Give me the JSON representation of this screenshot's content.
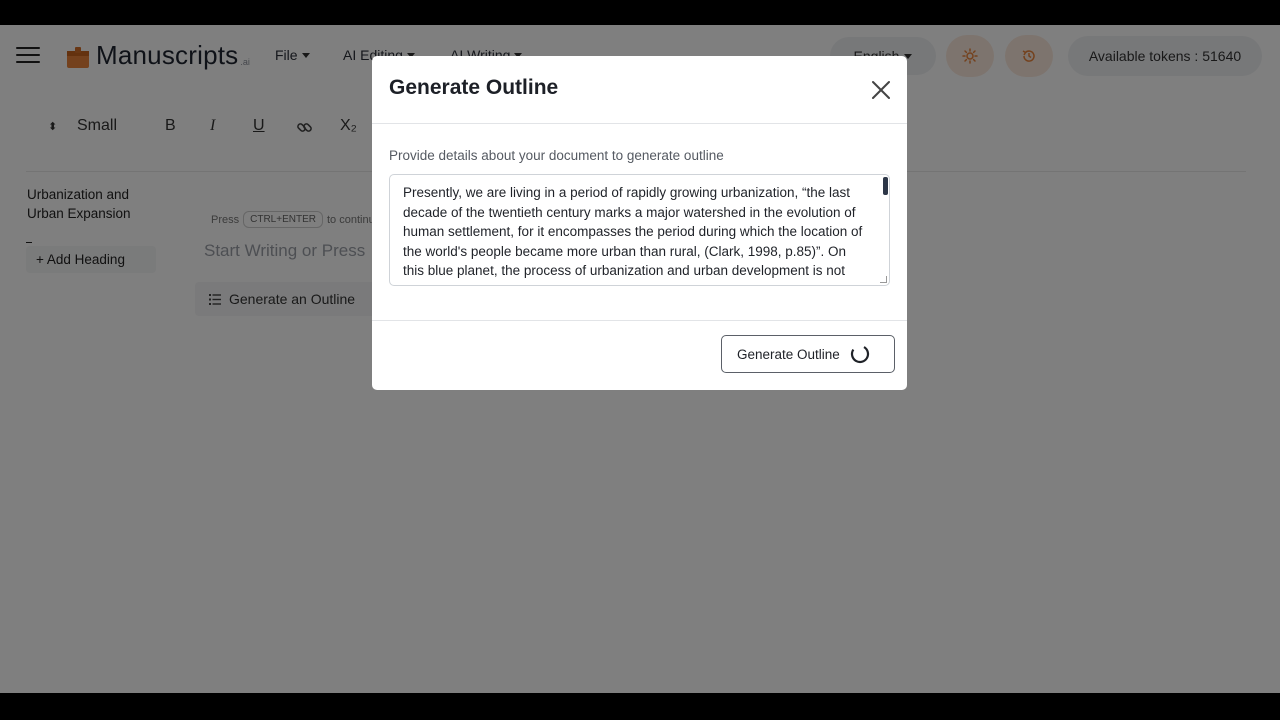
{
  "header": {
    "logo_text": "Manuscripts",
    "logo_suffix": ".ai",
    "menus": [
      {
        "label": "File"
      },
      {
        "label": "AI Editing"
      },
      {
        "label": "AI Writing"
      }
    ],
    "language": "English",
    "tokens_label": "Available tokens : 51640"
  },
  "toolbar": {
    "font_size": "Small",
    "bold": "B",
    "italic": "I",
    "underline": "U",
    "subscript": "X₂"
  },
  "sidebar": {
    "doc_title": "Urbanization and Urban Expansion",
    "add_heading": "+ Add Heading"
  },
  "editor": {
    "hint_prefix": "Press",
    "hint_key": "CTRL+ENTER",
    "hint_suffix": "to continue",
    "placeholder": "Start Writing or Press",
    "generate_outline_chip": "Generate an Outline"
  },
  "modal": {
    "title": "Generate Outline",
    "label": "Provide details about your document to generate outline",
    "text": "Presently, we are living in a period of rapidly growing urbanization, “the last decade of the twentieth century marks a major watershed in the evolution of human settlement, for it encompasses the period during which the location of the world's people became more urban than rural, (Clark, 1998, p.85)”. On this blue planet, the process of urbanization and urban development is not avoidable, thus the existence of human",
    "submit_label": "Generate Outline"
  },
  "colors": {
    "brand_orange": "#e8833a",
    "overlay": "#000000"
  }
}
